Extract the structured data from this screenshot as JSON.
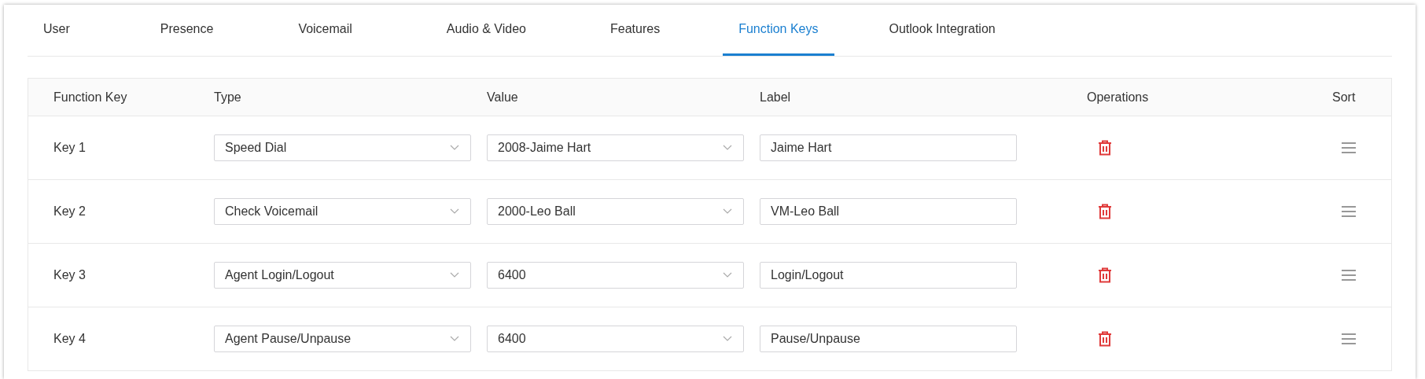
{
  "tabs": [
    {
      "label": "User",
      "selected": false
    },
    {
      "label": "Presence",
      "selected": false
    },
    {
      "label": "Voicemail",
      "selected": false
    },
    {
      "label": "Audio & Video",
      "selected": false
    },
    {
      "label": "Features",
      "selected": false
    },
    {
      "label": "Function Keys",
      "selected": true
    },
    {
      "label": "Outlook Integration",
      "selected": false
    }
  ],
  "table": {
    "columns": [
      "Function Key",
      "Type",
      "Value",
      "Label",
      "Operations",
      "Sort"
    ],
    "rows": [
      {
        "key": "Key 1",
        "type": "Speed Dial",
        "value": "2008-Jaime Hart",
        "label": "Jaime Hart"
      },
      {
        "key": "Key 2",
        "type": "Check Voicemail",
        "value": "2000-Leo Ball",
        "label": "VM-Leo Ball"
      },
      {
        "key": "Key 3",
        "type": "Agent Login/Logout",
        "value": "6400",
        "label": "Login/Logout"
      },
      {
        "key": "Key 4",
        "type": "Agent Pause/Unpause",
        "value": "6400",
        "label": "Pause/Unpause"
      }
    ]
  }
}
